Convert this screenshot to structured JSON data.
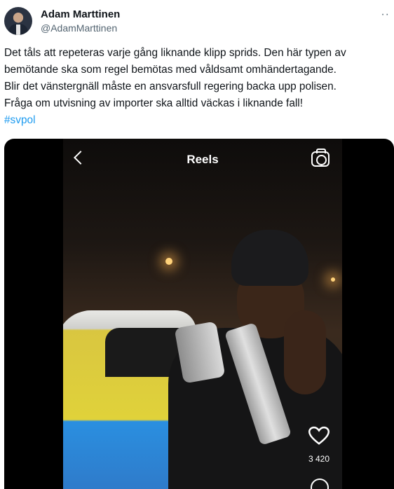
{
  "author": {
    "display_name": "Adam Marttinen",
    "handle": "@AdamMarttinen"
  },
  "more_menu": "··",
  "tweet": {
    "lines": [
      "Det tåls att repeteras varje gång liknande klipp sprids. Den här typen av",
      "bemötande ska som regel bemötas med våldsamt omhändertagande.",
      "Blir det vänstergnäll måste en ansvarsfull regering backa upp polisen.",
      "Fråga om utvisning av importer ska alltid väckas i liknande fall!"
    ],
    "hashtag": "#svpol"
  },
  "video": {
    "title": "Reels",
    "likes": "3 420"
  },
  "icons": {
    "back": "chevron-left-icon",
    "camera": "camera-icon",
    "heart": "heart-icon",
    "comment": "comment-icon"
  },
  "colors": {
    "text": "#0f1419",
    "secondary": "#536471",
    "link": "#1d9bf0"
  }
}
